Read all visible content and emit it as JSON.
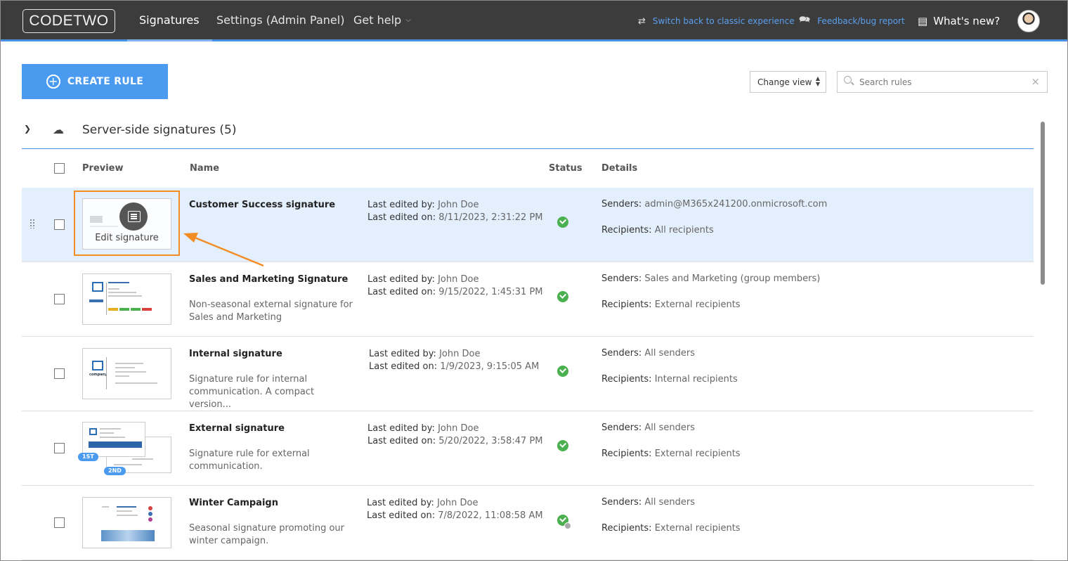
{
  "header": {
    "logo": "CODETWO",
    "nav": {
      "signatures": "Signatures",
      "settings": "Settings (Admin Panel)",
      "help": "Get help"
    },
    "switch_link": "Switch back to classic experience",
    "feedback_link": "Feedback/bug report",
    "whats_new": "What's new?"
  },
  "toolbar": {
    "create_rule": "CREATE RULE",
    "change_view": "Change view",
    "search_placeholder": "Search rules"
  },
  "group": {
    "title": "Server-side signatures (5)"
  },
  "table": {
    "headers": {
      "preview": "Preview",
      "name": "Name",
      "status": "Status",
      "details": "Details"
    },
    "edit_label": "Edit signature",
    "edited_by_label": "Last edited by:",
    "edited_on_label": "Last edited on:",
    "senders_label": "Senders:",
    "recipients_label": "Recipients:",
    "badge_1st": "1ST",
    "badge_2nd": "2ND",
    "rows": [
      {
        "name": "Customer Success signature",
        "desc": "",
        "edited_by": "John Doe",
        "edited_on": "8/11/2023, 2:31:22 PM",
        "senders": "admin@M365x241200.onmicrosoft.com",
        "recipients": "All recipients"
      },
      {
        "name": "Sales and Marketing Signature",
        "desc": "Non-seasonal external signature for Sales and Marketing",
        "edited_by": "John Doe",
        "edited_on": "9/15/2022, 1:45:31 PM",
        "senders": "Sales and Marketing (group members)",
        "recipients": "External recipients"
      },
      {
        "name": "Internal signature",
        "desc": "Signature rule for internal communication. A compact version...",
        "edited_by": "John Doe",
        "edited_on": "1/9/2023, 9:15:05 AM",
        "senders": "All senders",
        "recipients": "Internal recipients"
      },
      {
        "name": "External signature",
        "desc": "Signature rule for external communication.",
        "edited_by": "John Doe",
        "edited_on": "5/20/2022, 3:58:47 PM",
        "senders": "All senders",
        "recipients": "External recipients"
      },
      {
        "name": "Winter Campaign",
        "desc": "Seasonal signature promoting our winter campaign.",
        "edited_by": "John Doe",
        "edited_on": "7/8/2022, 11:08:58 AM",
        "senders": "All senders",
        "recipients": "External recipients"
      }
    ]
  },
  "colors": {
    "accent": "#4a9af0",
    "topbar": "#3c3c3c",
    "highlight": "#f28d26",
    "status_ok": "#4bb04f",
    "selected_row": "#e4effd"
  },
  "icons": [
    "switch-icon",
    "feedback-icon",
    "whats-new-icon",
    "plus-circle-icon",
    "search-icon",
    "clear-icon",
    "chevron-down-icon",
    "cloud-icon",
    "drag-handle-icon",
    "edit-signature-icon",
    "status-ok-icon",
    "clock-icon"
  ]
}
